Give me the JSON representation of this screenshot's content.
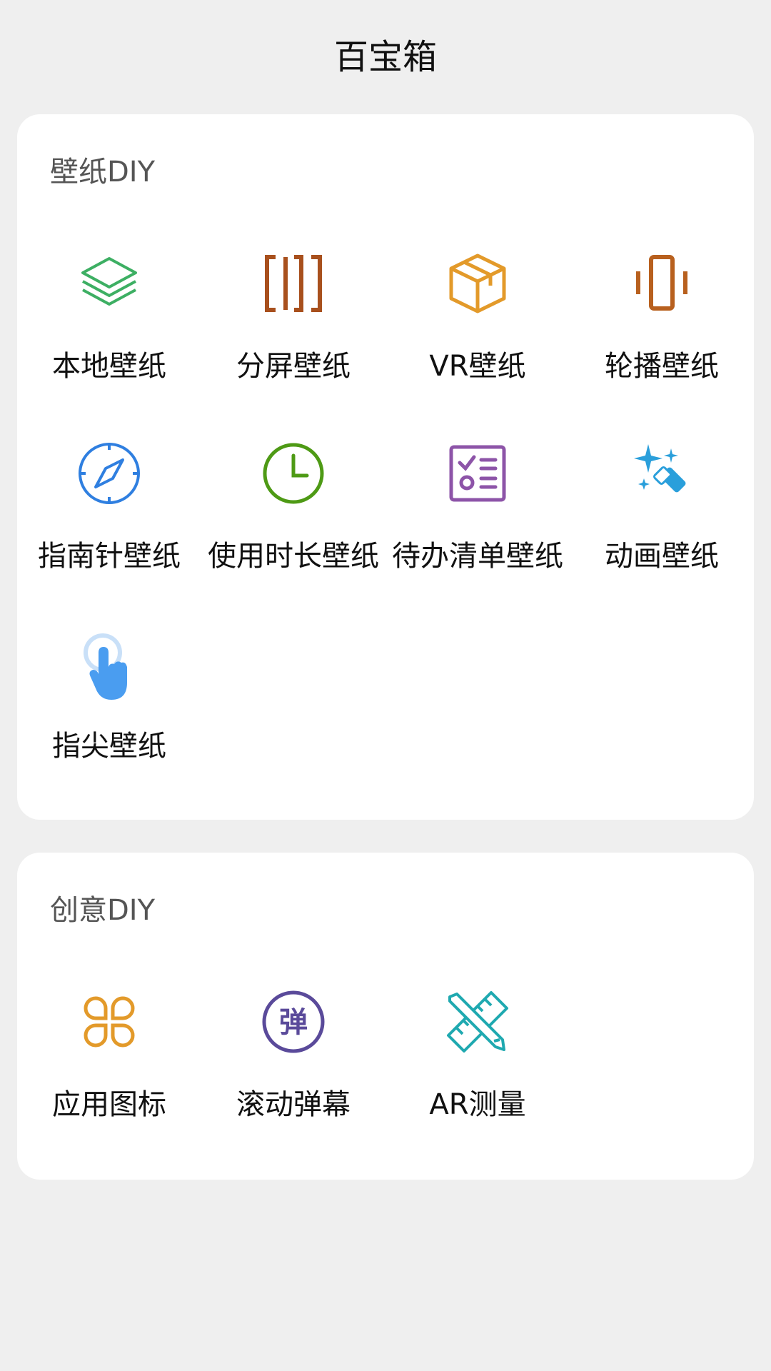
{
  "header": {
    "title": "百宝箱"
  },
  "wallpaper_section": {
    "title": "壁纸DIY",
    "items": [
      {
        "label": "本地壁纸",
        "icon": "layers-icon",
        "color": "#3daf63"
      },
      {
        "label": "分屏壁纸",
        "icon": "split-screen-icon",
        "color": "#a8501d"
      },
      {
        "label": "VR壁纸",
        "icon": "cube-icon",
        "color": "#e39a2a"
      },
      {
        "label": "轮播壁纸",
        "icon": "carousel-icon",
        "color": "#b8601e"
      },
      {
        "label": "指南针壁纸",
        "icon": "compass-icon",
        "color": "#2f7fe0"
      },
      {
        "label": "使用时长壁纸",
        "icon": "clock-icon",
        "color": "#4e9a15"
      },
      {
        "label": "待办清单壁纸",
        "icon": "checklist-icon",
        "color": "#8d54a8"
      },
      {
        "label": "动画壁纸",
        "icon": "sparkle-eraser-icon",
        "color": "#2a9fdb"
      },
      {
        "label": "指尖壁纸",
        "icon": "fingertip-icon",
        "color": "#4a9df0"
      }
    ]
  },
  "creative_section": {
    "title": "创意DIY",
    "items": [
      {
        "label": "应用图标",
        "icon": "app-icon-icon",
        "color": "#e39a2a"
      },
      {
        "label": "滚动弹幕",
        "icon": "danmaku-icon",
        "color": "#5a4a9a",
        "glyph": "弹"
      },
      {
        "label": "AR测量",
        "icon": "ruler-pencil-icon",
        "color": "#1fa9b0"
      }
    ]
  }
}
